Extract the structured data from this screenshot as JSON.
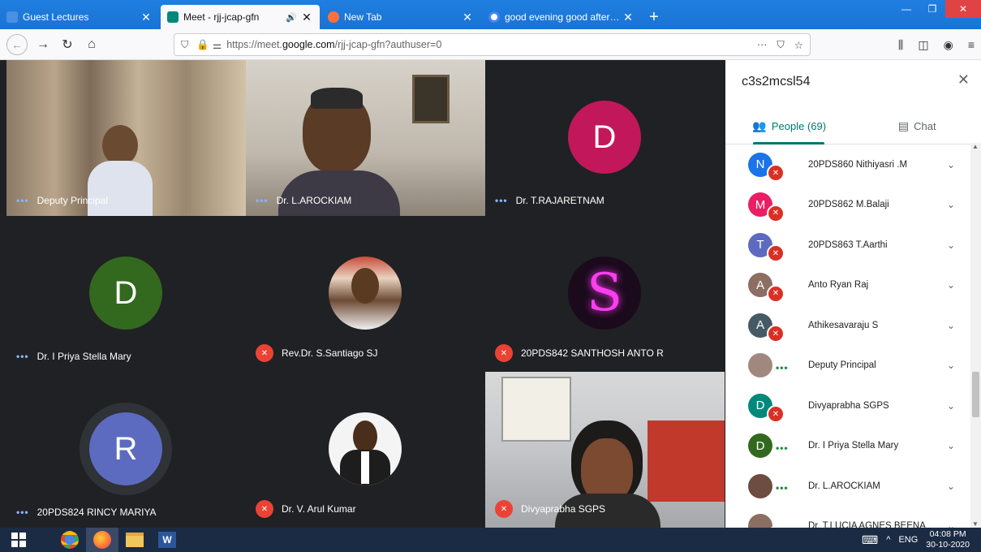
{
  "browser": {
    "tabs": [
      {
        "title": "Guest Lectures",
        "color": "#4a90e2"
      },
      {
        "title": "Meet - rjj-jcap-gfn",
        "color": "#00897b"
      },
      {
        "title": "New Tab",
        "color": "#ff7139"
      },
      {
        "title": "good evening good afternoon",
        "color": "#4285f4"
      }
    ],
    "url_prefix": "https://meet.",
    "url_host": "google.com",
    "url_path": "/rjj-jcap-gfn?authuser=0"
  },
  "meeting": {
    "tiles": [
      {
        "name": "Deputy Principal",
        "kind": "video",
        "status": "dots"
      },
      {
        "name": "Dr. L.AROCKIAM",
        "kind": "video",
        "status": "dots"
      },
      {
        "name": "Dr. T.RAJARETNAM",
        "kind": "avatar",
        "initial": "D",
        "color": "#c2185b",
        "status": "dots"
      },
      {
        "name": "Dr. I Priya Stella Mary",
        "kind": "avatar",
        "initial": "D",
        "color": "#33691e",
        "status": "dots"
      },
      {
        "name": "Rev.Dr. S.Santiago SJ",
        "kind": "photo",
        "status": "muted"
      },
      {
        "name": "20PDS842 SANTHOSH ANTO R",
        "kind": "photo",
        "status": "muted"
      },
      {
        "name": "20PDS824 RINCY MARIYA",
        "kind": "avatar",
        "initial": "R",
        "color": "#5c6bc0",
        "status": "dots"
      },
      {
        "name": "Dr. V. Arul Kumar",
        "kind": "photo",
        "status": "muted"
      },
      {
        "name": "Divyaprabha SGPS",
        "kind": "video",
        "status": "muted"
      }
    ]
  },
  "panel": {
    "title": "c3s2mcsl54",
    "people_tab": "People (69)",
    "chat_tab": "Chat",
    "people": [
      {
        "name": "20PDS860 Nithiyasri .M",
        "initial": "N",
        "color": "#1a73e8",
        "status": "muted"
      },
      {
        "name": "20PDS862 M.Balaji",
        "initial": "M",
        "color": "#e91e63",
        "status": "muted"
      },
      {
        "name": "20PDS863 T.Aarthi",
        "initial": "T",
        "color": "#5c6bc0",
        "status": "muted"
      },
      {
        "name": "Anto Ryan Raj",
        "initial": "A",
        "color": "#8d6e63",
        "status": "muted"
      },
      {
        "name": "Athikesavaraju S",
        "initial": "A",
        "color": "#455a64",
        "status": "muted"
      },
      {
        "name": "Deputy Principal",
        "initial": "",
        "color": "#a1887f",
        "status": "dots"
      },
      {
        "name": "Divyaprabha SGPS",
        "initial": "D",
        "color": "#00897b",
        "status": "muted"
      },
      {
        "name": "Dr. I Priya Stella Mary",
        "initial": "D",
        "color": "#33691e",
        "status": "dots"
      },
      {
        "name": "Dr. L.AROCKIAM",
        "initial": "",
        "color": "#6d4c41",
        "status": "dots"
      },
      {
        "name": "Dr. T.LUCIA AGNES BEENA",
        "initial": "",
        "color": "#8d6e63",
        "status": "muted"
      }
    ]
  },
  "taskbar": {
    "lang": "ENG",
    "time": "04:08 PM",
    "date": "30-10-2020"
  }
}
